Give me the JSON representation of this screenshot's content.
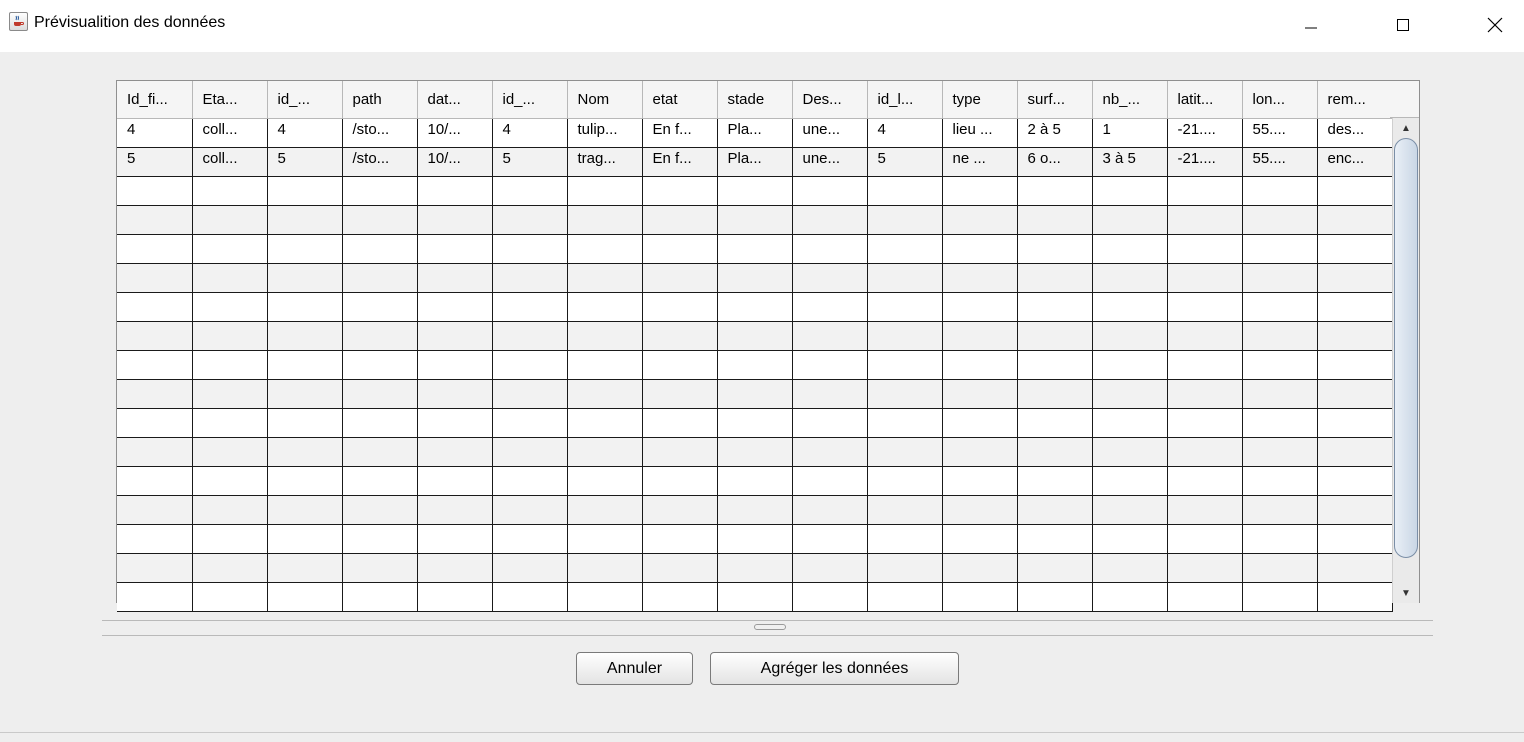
{
  "window": {
    "title": "Prévisualition des données",
    "icon": "java-cup-icon",
    "controls": {
      "minimize_icon": "minimize-icon",
      "maximize_icon": "maximize-icon",
      "close_icon": "close-icon"
    }
  },
  "table": {
    "columns": [
      "Id_fi...",
      "Eta...",
      "id_...",
      "path",
      "dat...",
      "id_...",
      "Nom",
      "etat",
      "stade",
      "Des...",
      "id_l...",
      "type",
      "surf...",
      "nb_...",
      "latit...",
      "lon...",
      "rem..."
    ],
    "rows": [
      [
        "4",
        "coll...",
        "4",
        "/sto...",
        "10/...",
        "4",
        "tulip...",
        "En f...",
        "Pla...",
        "une...",
        "4",
        "lieu ...",
        "2 à 5",
        "1",
        "-21....",
        "55....",
        "des..."
      ],
      [
        "5",
        "coll...",
        "5",
        "/sto...",
        "10/...",
        "5",
        "trag...",
        "En f...",
        "Pla...",
        "une...",
        "5",
        "ne ...",
        "6 o...",
        "3 à 5",
        "-21....",
        "55....",
        "enc..."
      ]
    ],
    "empty_rows": 15
  },
  "scrollbar": {
    "up_arrow": "▲",
    "down_arrow": "▼"
  },
  "buttons": {
    "cancel": "Annuler",
    "aggregate": "Agréger les données"
  }
}
